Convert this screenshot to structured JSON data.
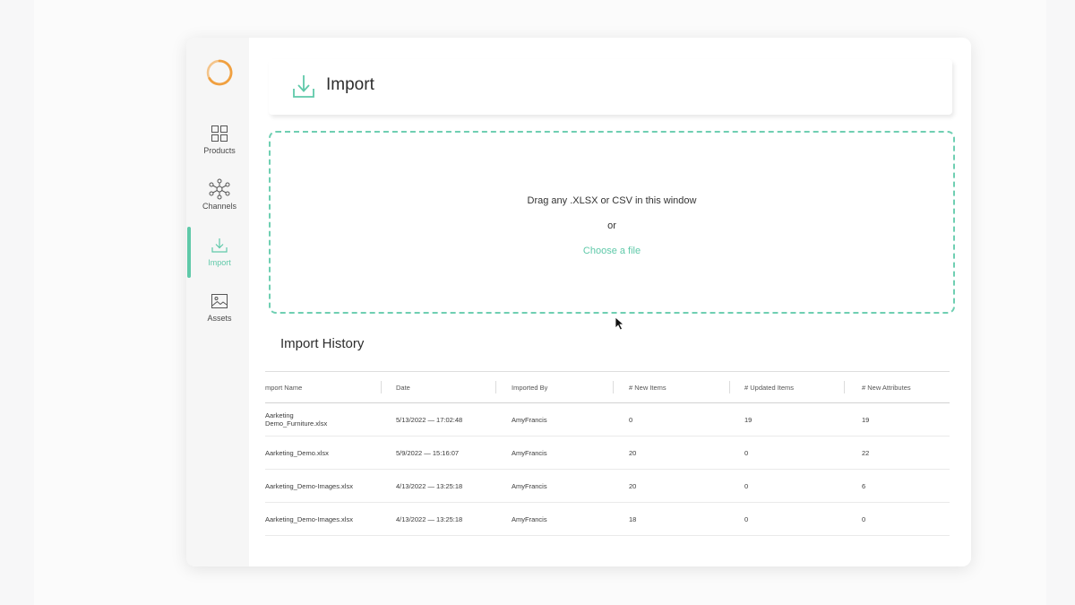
{
  "sidebar": {
    "items": [
      {
        "label": "Products",
        "icon": "grid-icon"
      },
      {
        "label": "Channels",
        "icon": "network-icon"
      },
      {
        "label": "Import",
        "icon": "download-icon",
        "active": true
      },
      {
        "label": "Assets",
        "icon": "image-icon"
      }
    ]
  },
  "header": {
    "title": "Import",
    "icon": "download-icon"
  },
  "dropzone": {
    "instruction": "Drag any .XLSX or CSV in this window",
    "or": "or",
    "choose_label": "Choose a file"
  },
  "history": {
    "title": "Import History",
    "columns": [
      "mport Name",
      "Date",
      "Imported By",
      "# New Items",
      "# Updated Items",
      "# New Attributes"
    ],
    "rows": [
      [
        "Aarketing\nDemo_Furniture.xlsx",
        "5/13/2022 — 17:02:48",
        "AmyFrancis",
        "0",
        "19",
        "19"
      ],
      [
        "Aarketing_Demo.xlsx",
        "5/9/2022 — 15:16:07",
        "AmyFrancis",
        "20",
        "0",
        "22"
      ],
      [
        "Aarketing_Demo-Images.xlsx",
        "4/13/2022 — 13:25:18",
        "AmyFrancis",
        "20",
        "0",
        "6"
      ],
      [
        "Aarketing_Demo-Images.xlsx",
        "4/13/2022 — 13:25:18",
        "AmyFrancis",
        "18",
        "0",
        "0"
      ]
    ]
  },
  "colors": {
    "accent": "#5fc9a9",
    "logo": "#f0a040"
  }
}
